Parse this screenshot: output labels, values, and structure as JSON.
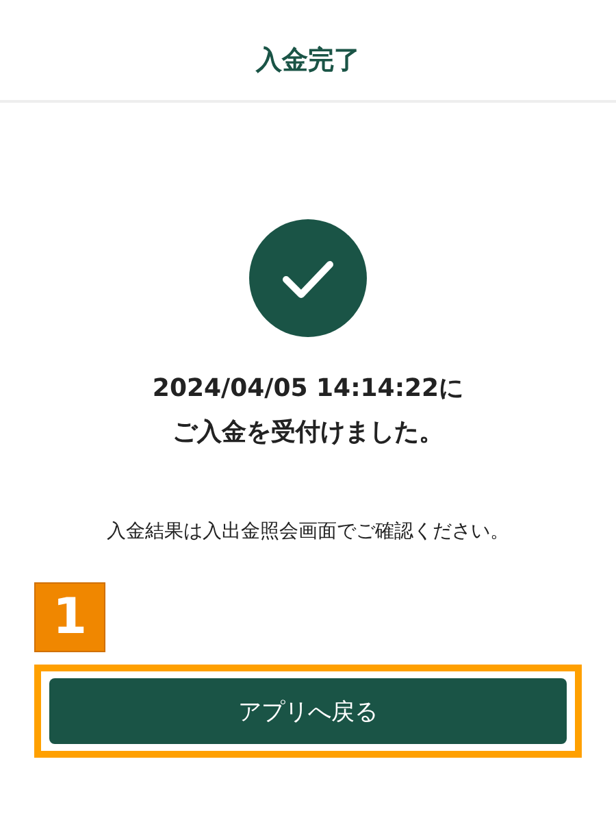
{
  "header": {
    "title": "入金完了"
  },
  "message": {
    "lines": [
      "2024/04/05 14:14:22に",
      "ご入金を受付けました。"
    ]
  },
  "note": "入金結果は入出金照会画面でご確認ください。",
  "annotation": {
    "label": "1"
  },
  "button": {
    "label": "アプリへ戻る"
  }
}
